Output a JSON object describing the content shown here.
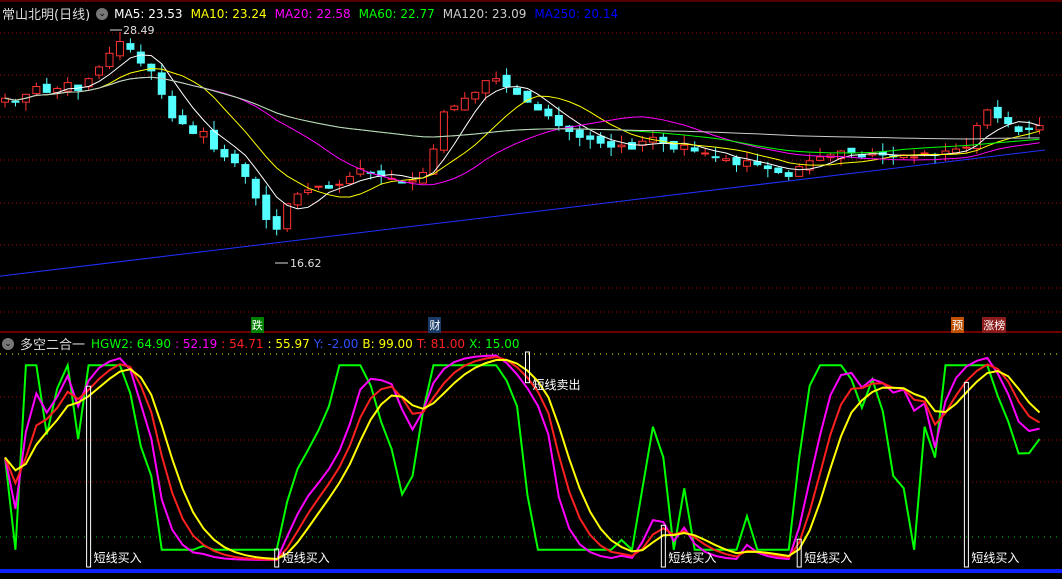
{
  "header": {
    "title": "常山北明(日线)",
    "ma": [
      {
        "label": "MA5: 23.53",
        "color": "#ffffff"
      },
      {
        "label": "MA10: 23.24",
        "color": "#ffff00"
      },
      {
        "label": "MA20: 22.58",
        "color": "#ff00ff"
      },
      {
        "label": "MA60: 22.77",
        "color": "#00ff00"
      },
      {
        "label": "MA120: 23.09",
        "color": "#cccccc"
      },
      {
        "label": "MA250: 20.14",
        "color": "#0000ff"
      }
    ]
  },
  "price_panel": {
    "high_label": "28.49",
    "low_label": "16.62",
    "ma250_range": [
      15.9,
      22.35
    ],
    "closes": [
      25.0,
      24.8,
      25.2,
      25.6,
      25.3,
      25.5,
      25.8,
      25.4,
      26.0,
      26.6,
      27.3,
      27.9,
      27.5,
      26.8,
      26.4,
      25.2,
      24.0,
      23.7,
      23.2,
      23.3,
      22.4,
      22.0,
      21.7,
      21.0,
      19.9,
      18.8,
      18.3,
      19.6,
      20.1,
      20.3,
      20.5,
      20.4,
      20.6,
      21.0,
      21.4,
      21.2,
      21.0,
      20.9,
      20.7,
      20.8,
      21.2,
      22.4,
      24.3,
      24.6,
      25.0,
      25.3,
      25.9,
      26.0,
      25.6,
      25.2,
      24.8,
      24.4,
      24.1,
      23.6,
      23.3,
      23.0,
      22.9,
      22.7,
      22.5,
      22.6,
      22.4,
      22.8,
      23.0,
      22.7,
      22.4,
      22.6,
      22.3,
      22.2,
      22.0,
      21.9,
      21.6,
      21.8,
      21.6,
      21.4,
      21.2,
      21.0,
      21.5,
      21.8,
      22.0,
      22.1,
      22.3,
      22.2,
      22.0,
      22.2,
      22.1,
      22.0,
      22.1,
      22.0,
      22.2,
      22.1,
      22.3,
      22.4,
      22.5,
      23.6,
      24.4,
      24.0,
      23.7,
      23.3,
      23.4,
      23.6
    ],
    "event_tags": [
      {
        "label": "跌",
        "bg": "#008000",
        "index": 24
      },
      {
        "label": "财",
        "bg": "#1a3a6a",
        "index": 41
      },
      {
        "label": "预",
        "bg": "#c05000",
        "index": 91
      },
      {
        "label": "涨榜",
        "bg": "#8b1a1a",
        "index": 94
      }
    ]
  },
  "indicator": {
    "title": "多空二合一",
    "values": [
      {
        "label": "HGW2: 64.90",
        "color": "#00ff00"
      },
      {
        "label": ": 52.19",
        "color": "#ff00ff"
      },
      {
        "label": ": 54.71",
        "color": "#ff2020"
      },
      {
        "label": ": 55.97",
        "color": "#ffff00"
      },
      {
        "label": "Y: -2.00",
        "color": "#3050ff"
      },
      {
        "label": "B: 99.00",
        "color": "#ffff00"
      },
      {
        "label": "T: 81.00",
        "color": "#ff2020"
      },
      {
        "label": "X: 15.00",
        "color": "#00ff00"
      }
    ],
    "signals": [
      {
        "label": "短线买入",
        "index": 8,
        "type": "buy"
      },
      {
        "label": "短线买入",
        "index": 26,
        "type": "buy"
      },
      {
        "label": "短线卖出",
        "index": 50,
        "type": "sell"
      },
      {
        "label": "短线买入",
        "index": 63,
        "type": "buy"
      },
      {
        "label": "短线买入",
        "index": 76,
        "type": "buy"
      },
      {
        "label": "短线买入",
        "index": 92,
        "type": "buy"
      }
    ]
  }
}
